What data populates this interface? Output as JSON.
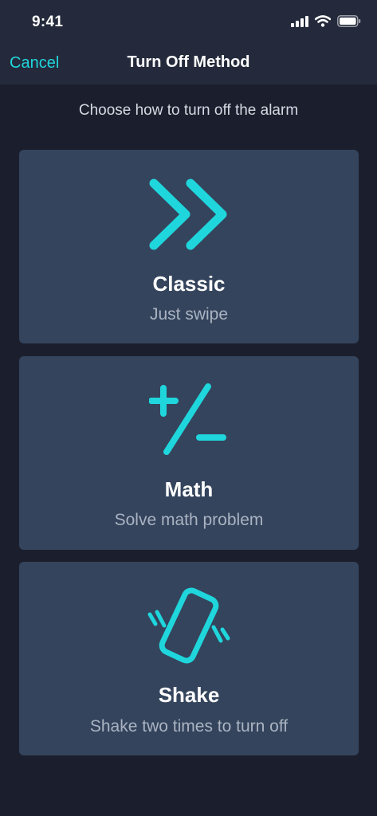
{
  "status_bar": {
    "time": "9:41"
  },
  "nav": {
    "cancel_label": "Cancel",
    "title": "Turn Off Method"
  },
  "subtitle": "Choose how to turn off the alarm",
  "methods": [
    {
      "title": "Classic",
      "description": "Just swipe",
      "icon": "double-chevron-right-icon"
    },
    {
      "title": "Math",
      "description": "Solve math problem",
      "icon": "plus-minus-icon"
    },
    {
      "title": "Shake",
      "description": "Shake two times to turn off",
      "icon": "shaking-phone-icon"
    }
  ],
  "colors": {
    "accent": "#1fd6dc",
    "background": "#1b1f2d",
    "card": "#34445c",
    "bar": "#242a3b"
  }
}
